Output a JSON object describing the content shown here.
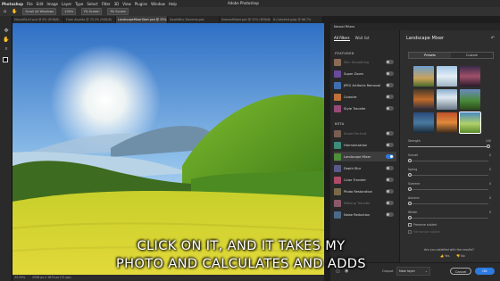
{
  "menubar": {
    "app": "Photoshop",
    "items": [
      "File",
      "Edit",
      "Image",
      "Layer",
      "Type",
      "Select",
      "Filter",
      "3D",
      "View",
      "Plugins",
      "Window",
      "Help"
    ],
    "window_title": "Adobe Photoshop"
  },
  "options": {
    "scroll_all": "Scroll All Windows",
    "zoom": "100%",
    "fit_screen": "Fit Screen",
    "fill_screen": "Fill Screen"
  },
  "tabs": [
    {
      "label": "MountBlur3.psd @ 8% (RGB/8)"
    },
    {
      "label": "From Alcaide @ 33.3% (RGB/8)"
    },
    {
      "label": "LandscapeMixerStart.psd @ 33% (Layer 1, RGB/8)",
      "active": true
    },
    {
      "label": "DepthBlur-Traverdo.psd"
    },
    {
      "label": "SeasonMixed.psd @ 33% (RGB/8)"
    },
    {
      "label": "6-Colortest.jpeg @ 66.7%"
    }
  ],
  "status": {
    "zoom": "33.33%",
    "size": "2556 px x 1674 px (72 ppi)"
  },
  "neural_filters": {
    "header": "Neural Filters",
    "list_tabs": [
      "All filters",
      "Wait list"
    ],
    "featured_label": "FEATURED",
    "beta_label": "BETA",
    "featured": [
      {
        "name": "Skin Smoothing",
        "dim": true
      },
      {
        "name": "Super Zoom",
        "dim": false
      },
      {
        "name": "JPEG Artifacts Removal",
        "dim": false
      },
      {
        "name": "Colorize",
        "dim": false
      },
      {
        "name": "Style Transfer",
        "dim": false
      }
    ],
    "beta": [
      {
        "name": "Smart Portrait",
        "dim": true
      },
      {
        "name": "Harmonization",
        "dim": false
      },
      {
        "name": "Landscape Mixer",
        "dim": false,
        "selected": true
      },
      {
        "name": "Depth Blur",
        "dim": false
      },
      {
        "name": "Color Transfer",
        "dim": false
      },
      {
        "name": "Photo Restoration",
        "dim": false
      },
      {
        "name": "Makeup Transfer",
        "dim": true
      },
      {
        "name": "Noise Reduction",
        "dim": false
      }
    ]
  },
  "detail": {
    "title": "Landscape Mixer",
    "segments": [
      "Presets",
      "Custom"
    ],
    "sliders": [
      {
        "label": "Strength",
        "value": "100"
      },
      {
        "label": "Sunset",
        "value": "0"
      },
      {
        "label": "Spring",
        "value": "0"
      },
      {
        "label": "Summer",
        "value": "0"
      },
      {
        "label": "Autumn",
        "value": "0"
      },
      {
        "label": "Winter",
        "value": "0"
      }
    ],
    "preserve_subject": "Preserve subject",
    "harmonize_subject": "Harmonize subject",
    "feedback": "Are you satisfied with the results?",
    "yes": "Yes",
    "no": "No"
  },
  "bottom": {
    "output_label": "Output",
    "output_value": "New layer",
    "cancel": "Cancel",
    "ok": "OK"
  },
  "caption": {
    "line1": "CLICK ON IT, AND IT TAKES MY",
    "line2": "PHOTO AND CALCULATES AND ADDS"
  },
  "colors": {
    "accent": "#2d7ae0",
    "toggle_on": "#2d7ae0"
  }
}
